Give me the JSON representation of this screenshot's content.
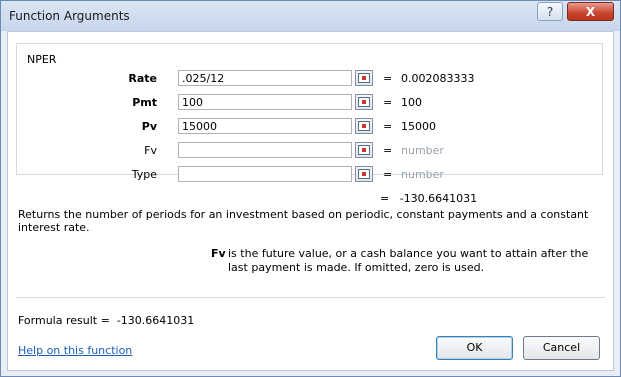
{
  "window": {
    "title": "Function Arguments",
    "help_glyph": "?",
    "close_glyph": "X"
  },
  "function": {
    "name": "NPER",
    "arguments": [
      {
        "label": "Rate",
        "value": ".025/12",
        "result": "0.002083333",
        "empty": false
      },
      {
        "label": "Pmt",
        "value": "100",
        "result": "100",
        "empty": false
      },
      {
        "label": "Pv",
        "value": "15000",
        "result": "15000",
        "empty": false
      },
      {
        "label": "Fv",
        "value": "",
        "result": "number",
        "empty": true
      },
      {
        "label": "Type",
        "value": "",
        "result": "number",
        "empty": true
      }
    ],
    "equals_sign": "=",
    "result": "-130.6641031",
    "description": "Returns the number of periods for an investment based on periodic, constant payments and a constant interest rate.",
    "arg_help_name": "Fv",
    "arg_help_text": "is the future value, or a cash balance you want to attain after the last payment is made. If omitted, zero is used."
  },
  "footer": {
    "formula_result_label": "Formula result =",
    "formula_result_value": "-130.6641031",
    "help_link": "Help on this function",
    "ok_label": "OK",
    "cancel_label": "Cancel"
  },
  "colors": {
    "link": "#1a5fb4",
    "close_button": "#c9452f",
    "placeholder_text": "#9aa3ad"
  }
}
